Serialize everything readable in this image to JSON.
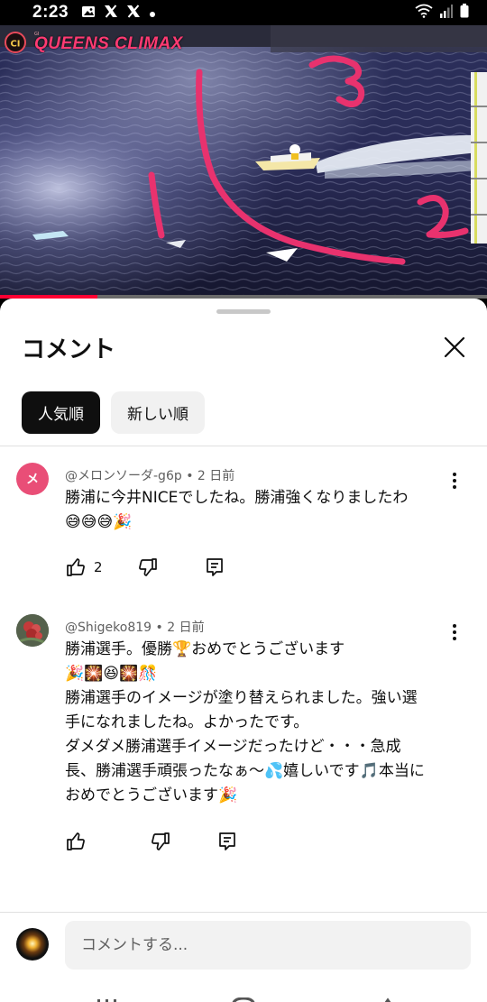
{
  "status_bar": {
    "time": "2:23",
    "icons": [
      "image-icon",
      "x-icon",
      "x-icon",
      "dot-icon",
      "wifi-icon",
      "signal-icon",
      "battery-icon"
    ]
  },
  "video": {
    "watermark": "QUEENS CLIMAX",
    "progress": 0.2
  },
  "sheet": {
    "title": "コメント",
    "sort_chips": [
      "人気順",
      "新しい順"
    ],
    "active_chip": "人気順"
  },
  "comments": [
    {
      "author": "@メロンソーダ-g6p",
      "time": "2 日前",
      "avatar_letter": "メ",
      "avatar_color": "#e94e77",
      "lines": [
        "勝浦に今井NICEでしたね。勝浦強くなりましたわ",
        "😅😅😅🎉"
      ],
      "likes": "2"
    },
    {
      "author": "@Shigeko819",
      "time": "2 日前",
      "lines": [
        "勝浦選手。優勝🏆おめでとうございます",
        "🎉🎇😆🎇🎊",
        "勝浦選手のイメージが塗り替えられました。強い選",
        "手になれましたね。よかったです。",
        "ダメダメ勝浦選手イメージだったけど・・・急成",
        "長、勝浦選手頑張ったなぁ〜💦嬉しいです🎵本当に",
        "おめでとうございます🎉"
      ],
      "likes": ""
    }
  ],
  "composer": {
    "placeholder": "コメントする..."
  },
  "colors": {
    "accent": "#ff0033",
    "annotation": "#e8326e"
  }
}
